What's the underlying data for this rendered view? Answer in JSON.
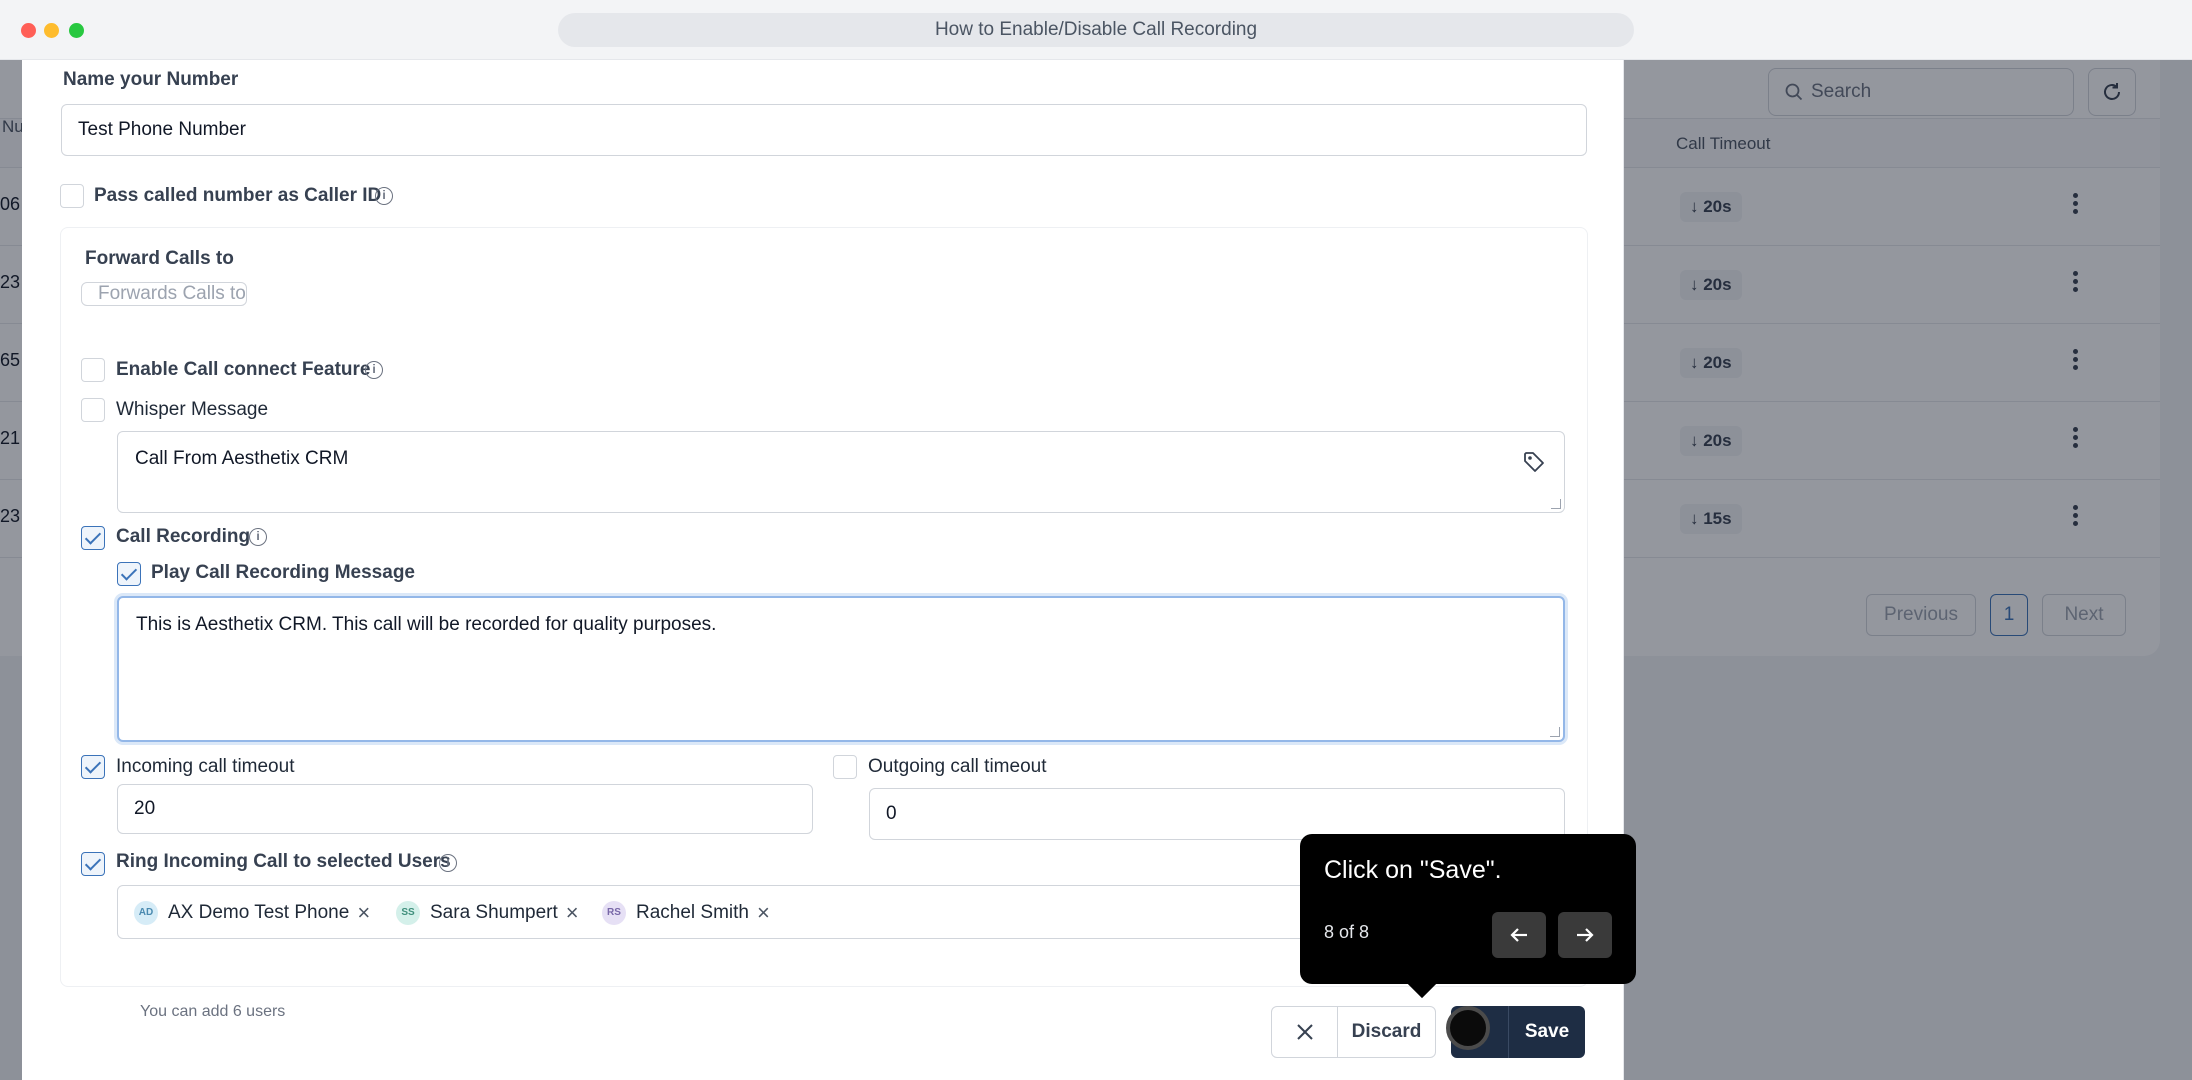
{
  "window": {
    "title": "How to Enable/Disable Call Recording"
  },
  "background": {
    "search_placeholder": "Search",
    "header_edge": "Nu",
    "column_call_timeout": "Call Timeout",
    "rows": [
      {
        "edge": "06",
        "timeout": "↓ 20s"
      },
      {
        "edge": "23",
        "timeout": "↓ 20s"
      },
      {
        "edge": "65",
        "timeout": "↓ 20s"
      },
      {
        "edge": "21",
        "timeout": "↓ 20s"
      },
      {
        "edge": "23",
        "timeout": "↓ 15s"
      }
    ],
    "pager": {
      "previous": "Previous",
      "page": "1",
      "next": "Next"
    }
  },
  "form": {
    "name_label": "Name your Number",
    "name_value": "Test Phone Number",
    "pass_caller_id_label": "Pass called number as Caller ID",
    "forward_calls_label": "Forward Calls to",
    "forward_calls_placeholder": "Forwards Calls to",
    "call_connect_label": "Enable Call connect Feature",
    "whisper_label": "Whisper Message",
    "whisper_value": "Call From Aesthetix CRM",
    "call_recording_label": "Call Recording",
    "play_recording_label": "Play Call Recording Message",
    "recording_message": "This is Aesthetix CRM. This call will be recorded for quality purposes.",
    "incoming_timeout_label": "Incoming call timeout",
    "incoming_timeout_value": "20",
    "outgoing_timeout_label": "Outgoing call timeout",
    "outgoing_timeout_value": "0",
    "ring_users_label": "Ring Incoming Call to selected Users",
    "users": [
      {
        "initials": "AD",
        "name": "AX Demo Test Phone",
        "color": "#d6ecf7",
        "text": "#4a8ab0"
      },
      {
        "initials": "SS",
        "name": "Sara Shumpert",
        "color": "#d4f0ea",
        "text": "#3f8f7c"
      },
      {
        "initials": "RS",
        "name": "Rachel Smith",
        "color": "#e6e0f5",
        "text": "#7867a8"
      }
    ],
    "users_hint": "You can add 6 users",
    "discard_label": "Discard",
    "save_label": "Save"
  },
  "tooltip": {
    "message": "Click on \"Save\".",
    "step": "8 of 8"
  }
}
